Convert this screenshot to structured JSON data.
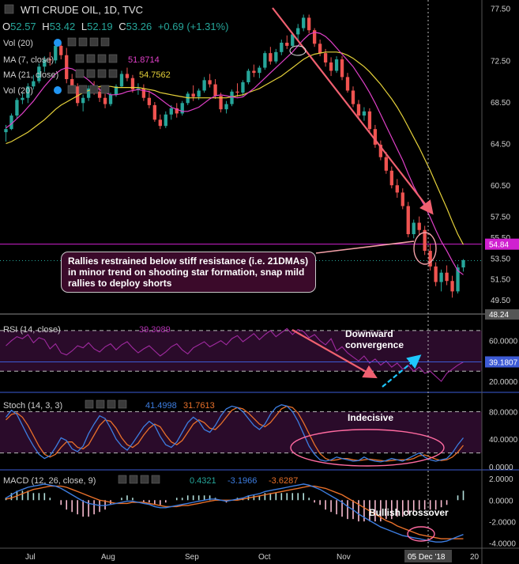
{
  "header": {
    "title": "WTI CRUDE OIL, 1D, TVC",
    "open_label": "O",
    "open": "52.57",
    "high_label": "H",
    "high": "53.42",
    "low_label": "L",
    "low": "52.19",
    "close_label": "C",
    "close": "53.26",
    "change": "+0.69 (+1.31%)"
  },
  "indicators": {
    "vol": "Vol (20)",
    "ma7": "MA (7, close)",
    "ma7_value": "51.8714",
    "ma21": "MA (21, close)",
    "ma21_value": "54.7562",
    "vol2": "Vol (20)",
    "rsi": "RSI (14, close)",
    "rsi_value": "39.3089",
    "stoch": "Stoch (14, 3, 3)",
    "stoch_k": "41.4998",
    "stoch_d": "31.7613",
    "macd": "MACD (12, 26, close, 9)",
    "macd_1": "0.4321",
    "macd_2": "-3.1966",
    "macd_3": "-3.6287"
  },
  "annotations": {
    "note": "Rallies restrained below stiff resistance (i.e. 21DMAs) in minor trend on shooting star formation, snap mild rallies to deploy shorts",
    "rsi_note_1": "Downward",
    "rsi_note_2": "convergence",
    "stoch_note": "Indecisive",
    "macd_note": "Bullish crossover"
  },
  "colors": {
    "up": "#26a69a",
    "down": "#ef5350",
    "ma7": "#e040c8",
    "ma21": "#e6d23a",
    "resistance": "#d020d0",
    "band": "#2a0b2a",
    "trend_arrow": "#f06070",
    "cyan_arrow": "#1ec8ff",
    "macd_line": "#3d7de0",
    "signal_line": "#e8702a",
    "stoch_k": "#3d7de0",
    "stoch_d": "#e8702a"
  },
  "chart_data": {
    "type": "candlestick",
    "x_labels": [
      "Jul",
      "Aug",
      "Sep",
      "Oct",
      "Nov",
      "Dec",
      "20"
    ],
    "cursor_date": "05 Dec '18",
    "price_axis_ticks": [
      "77.50",
      "72.50",
      "68.50",
      "64.50",
      "60.50",
      "57.50",
      "55.50",
      "53.50",
      "51.50",
      "49.50"
    ],
    "price_ylim": [
      48.2,
      78.0
    ],
    "resistance_level": "54.84",
    "last_low_label": "48.24",
    "price_series": [
      [
        65.6,
        66.3,
        64.7,
        65.9
      ],
      [
        65.9,
        67.4,
        65.8,
        67.2
      ],
      [
        67.2,
        68.9,
        66.9,
        68.7
      ],
      [
        68.7,
        69.4,
        68.3,
        68.9
      ],
      [
        68.9,
        70.3,
        68.4,
        70.0
      ],
      [
        70.0,
        71.1,
        69.7,
        70.5
      ],
      [
        70.5,
        72.2,
        70.3,
        71.9
      ],
      [
        71.9,
        72.9,
        71.4,
        72.6
      ],
      [
        72.6,
        73.3,
        72.0,
        72.5
      ],
      [
        72.5,
        74.3,
        72.2,
        73.9
      ],
      [
        73.9,
        74.2,
        72.6,
        73.0
      ],
      [
        73.0,
        73.7,
        70.3,
        70.7
      ],
      [
        70.7,
        71.2,
        69.6,
        70.0
      ],
      [
        70.0,
        70.3,
        68.1,
        68.4
      ],
      [
        68.4,
        69.2,
        67.6,
        68.9
      ],
      [
        68.9,
        70.1,
        68.6,
        69.8
      ],
      [
        69.8,
        70.5,
        69.2,
        69.5
      ],
      [
        69.5,
        70.0,
        68.5,
        68.9
      ],
      [
        68.9,
        69.3,
        67.9,
        68.3
      ],
      [
        68.3,
        69.4,
        68.1,
        69.2
      ],
      [
        69.2,
        70.2,
        69.0,
        70.0
      ],
      [
        70.0,
        71.5,
        69.9,
        71.2
      ],
      [
        71.2,
        71.8,
        70.5,
        70.8
      ],
      [
        70.8,
        71.1,
        69.4,
        69.7
      ],
      [
        69.7,
        70.3,
        69.2,
        69.8
      ],
      [
        69.8,
        70.2,
        68.6,
        68.9
      ],
      [
        68.9,
        69.6,
        67.9,
        68.2
      ],
      [
        68.2,
        68.5,
        66.6,
        66.8
      ],
      [
        66.8,
        67.3,
        65.9,
        66.2
      ],
      [
        66.2,
        67.6,
        66.0,
        67.3
      ],
      [
        67.3,
        68.2,
        66.8,
        67.9
      ],
      [
        67.9,
        68.4,
        67.0,
        67.4
      ],
      [
        67.4,
        68.6,
        67.2,
        68.4
      ],
      [
        68.4,
        69.5,
        68.2,
        69.3
      ],
      [
        69.3,
        70.1,
        68.6,
        69.0
      ],
      [
        69.0,
        69.8,
        68.7,
        69.6
      ],
      [
        69.6,
        70.9,
        69.4,
        70.6
      ],
      [
        70.6,
        71.2,
        69.9,
        70.2
      ],
      [
        70.2,
        70.7,
        68.8,
        69.1
      ],
      [
        69.1,
        69.4,
        67.5,
        67.8
      ],
      [
        67.8,
        68.6,
        67.4,
        68.3
      ],
      [
        68.3,
        69.7,
        68.1,
        69.5
      ],
      [
        69.5,
        70.3,
        69.0,
        69.4
      ],
      [
        69.4,
        70.6,
        69.1,
        70.4
      ],
      [
        70.4,
        71.7,
        70.2,
        71.5
      ],
      [
        71.5,
        72.1,
        70.9,
        71.3
      ],
      [
        71.3,
        72.0,
        70.8,
        71.8
      ],
      [
        71.8,
        73.4,
        71.6,
        73.2
      ],
      [
        73.2,
        73.8,
        72.1,
        72.4
      ],
      [
        72.4,
        73.6,
        72.2,
        73.3
      ],
      [
        73.3,
        74.5,
        73.0,
        74.2
      ],
      [
        74.2,
        74.9,
        73.6,
        73.9
      ],
      [
        73.9,
        75.2,
        73.8,
        75.0
      ],
      [
        75.0,
        76.0,
        74.4,
        75.6
      ],
      [
        75.6,
        76.9,
        75.3,
        76.6
      ],
      [
        76.6,
        76.9,
        75.1,
        75.4
      ],
      [
        75.4,
        75.6,
        73.8,
        74.1
      ],
      [
        74.1,
        74.5,
        72.9,
        73.2
      ],
      [
        73.2,
        73.6,
        71.9,
        72.3
      ],
      [
        72.3,
        72.8,
        71.0,
        71.5
      ],
      [
        71.5,
        72.9,
        71.3,
        72.6
      ],
      [
        72.6,
        72.9,
        70.6,
        70.9
      ],
      [
        70.9,
        71.3,
        69.4,
        69.6
      ],
      [
        69.6,
        70.0,
        68.0,
        68.3
      ],
      [
        68.3,
        68.7,
        66.9,
        67.2
      ],
      [
        67.2,
        68.0,
        66.7,
        67.6
      ],
      [
        67.6,
        67.9,
        65.6,
        65.9
      ],
      [
        65.9,
        66.3,
        64.1,
        64.4
      ],
      [
        64.4,
        64.8,
        62.9,
        63.2
      ],
      [
        63.2,
        63.7,
        61.6,
        61.9
      ],
      [
        61.9,
        62.3,
        60.2,
        60.5
      ],
      [
        60.5,
        61.1,
        59.3,
        59.8
      ],
      [
        59.8,
        60.2,
        58.2,
        58.5
      ],
      [
        58.5,
        58.9,
        55.5,
        55.8
      ],
      [
        55.8,
        57.2,
        55.4,
        56.9
      ],
      [
        56.9,
        57.5,
        55.8,
        56.2
      ],
      [
        56.2,
        56.6,
        53.8,
        54.2
      ],
      [
        54.2,
        54.9,
        52.3,
        52.7
      ],
      [
        52.7,
        53.1,
        50.8,
        51.2
      ],
      [
        51.2,
        52.4,
        50.3,
        52.1
      ],
      [
        52.1,
        52.8,
        50.9,
        51.3
      ],
      [
        51.3,
        51.8,
        49.7,
        50.3
      ],
      [
        50.3,
        52.9,
        50.1,
        52.6
      ],
      [
        52.6,
        53.4,
        52.2,
        53.3
      ]
    ],
    "ma7": [
      66.0,
      66.4,
      66.9,
      67.4,
      68.0,
      68.6,
      69.3,
      70.0,
      70.6,
      71.2,
      71.6,
      71.8,
      71.7,
      71.4,
      71.0,
      70.6,
      70.1,
      69.7,
      69.4,
      69.2,
      69.2,
      69.3,
      69.5,
      69.6,
      69.7,
      69.6,
      69.5,
      69.2,
      68.8,
      68.4,
      68.0,
      67.8,
      67.6,
      67.6,
      67.8,
      68.0,
      68.4,
      68.8,
      69.1,
      69.2,
      69.1,
      69.0,
      68.9,
      69.0,
      69.4,
      69.8,
      70.3,
      70.8,
      71.3,
      71.8,
      72.3,
      72.8,
      73.3,
      73.9,
      74.5,
      75.0,
      75.2,
      75.1,
      74.8,
      74.3,
      73.7,
      73.1,
      72.5,
      71.9,
      71.1,
      70.3,
      69.4,
      68.4,
      67.3,
      66.2,
      65.1,
      64.0,
      62.9,
      61.6,
      60.4,
      59.4,
      58.5,
      57.4,
      56.2,
      55.1,
      54.2,
      53.2,
      52.3,
      51.9
    ],
    "ma21": [
      64.5,
      64.7,
      65.0,
      65.3,
      65.6,
      66.0,
      66.4,
      66.8,
      67.3,
      67.8,
      68.2,
      68.5,
      68.8,
      69.1,
      69.4,
      69.6,
      69.8,
      70.0,
      70.0,
      70.0,
      69.9,
      69.9,
      69.9,
      69.9,
      69.9,
      69.8,
      69.7,
      69.6,
      69.4,
      69.3,
      69.2,
      69.1,
      69.0,
      68.9,
      68.9,
      68.9,
      68.9,
      68.9,
      68.9,
      68.9,
      68.9,
      69.0,
      69.1,
      69.2,
      69.4,
      69.6,
      69.8,
      70.1,
      70.4,
      70.7,
      71.0,
      71.4,
      71.8,
      72.2,
      72.6,
      72.9,
      73.1,
      73.2,
      73.3,
      73.3,
      73.3,
      73.2,
      73.0,
      72.7,
      72.3,
      71.9,
      71.4,
      70.8,
      70.2,
      69.5,
      68.8,
      68.0,
      67.1,
      66.1,
      65.1,
      64.1,
      63.0,
      61.9,
      60.7,
      59.5,
      58.3,
      57.0,
      55.8,
      54.8
    ],
    "rsi_ylim": [
      10,
      80
    ],
    "rsi_ticks": [
      "60.0000",
      "39.1807",
      "20.0000"
    ],
    "rsi_levels": [
      70,
      30
    ],
    "rsi": [
      55,
      60,
      64,
      62,
      66,
      58,
      63,
      61,
      52,
      57,
      48,
      46,
      50,
      55,
      53,
      58,
      52,
      49,
      54,
      57,
      51,
      56,
      59,
      53,
      48,
      52,
      55,
      50,
      45,
      49,
      54,
      57,
      51,
      47,
      53,
      56,
      59,
      54,
      57,
      60,
      56,
      62,
      65,
      59,
      63,
      67,
      61,
      66,
      70,
      64,
      68,
      72,
      66,
      71,
      69,
      63,
      66,
      60,
      56,
      62,
      50,
      54,
      48,
      44,
      40,
      45,
      38,
      42,
      36,
      40,
      34,
      38,
      32,
      36,
      30,
      34,
      28,
      30,
      25,
      20,
      28,
      32,
      36,
      39
    ],
    "stoch_ylim": [
      0,
      100
    ],
    "stoch_ticks": [
      "80.0000",
      "40.0000",
      "0.0000"
    ],
    "stoch_levels": [
      80,
      20
    ],
    "stoch_k_series": [
      72,
      82,
      76,
      60,
      44,
      30,
      18,
      12,
      16,
      28,
      42,
      38,
      26,
      22,
      30,
      48,
      62,
      74,
      70,
      56,
      40,
      30,
      24,
      34,
      46,
      58,
      66,
      60,
      44,
      32,
      28,
      36,
      50,
      64,
      72,
      66,
      54,
      50,
      60,
      74,
      84,
      88,
      86,
      80,
      70,
      60,
      54,
      62,
      76,
      86,
      90,
      88,
      80,
      66,
      48,
      30,
      18,
      10,
      8,
      10,
      14,
      12,
      10,
      8,
      9,
      14,
      10,
      8,
      7,
      9,
      12,
      10,
      8,
      12,
      16,
      20,
      14,
      10,
      8,
      10,
      12,
      20,
      32,
      42
    ],
    "stoch_d_series": [
      68,
      76,
      78,
      72,
      60,
      45,
      30,
      18,
      14,
      18,
      28,
      36,
      36,
      28,
      26,
      32,
      46,
      60,
      68,
      66,
      56,
      42,
      32,
      28,
      34,
      46,
      56,
      62,
      58,
      46,
      36,
      32,
      38,
      50,
      62,
      68,
      64,
      56,
      54,
      62,
      72,
      82,
      86,
      84,
      78,
      70,
      62,
      58,
      64,
      74,
      84,
      88,
      86,
      78,
      64,
      48,
      32,
      19,
      12,
      9,
      10,
      12,
      12,
      10,
      9,
      10,
      11,
      10,
      9,
      8,
      9,
      10,
      10,
      10,
      12,
      16,
      17,
      14,
      11,
      9,
      10,
      14,
      21,
      31
    ],
    "macd_ylim": [
      -4.4,
      2.6
    ],
    "macd_ticks": [
      "2.0000",
      "0.0000",
      "-2.0000",
      "-4.0000"
    ],
    "macd_line": [
      0.2,
      0.5,
      0.8,
      1.0,
      1.2,
      1.3,
      1.4,
      1.5,
      1.4,
      1.3,
      1.1,
      0.8,
      0.5,
      0.2,
      -0.1,
      -0.3,
      -0.4,
      -0.5,
      -0.5,
      -0.4,
      -0.3,
      -0.2,
      -0.1,
      -0.1,
      -0.2,
      -0.3,
      -0.4,
      -0.6,
      -0.7,
      -0.7,
      -0.6,
      -0.5,
      -0.4,
      -0.3,
      -0.2,
      -0.1,
      0.0,
      0.1,
      0.1,
      0.0,
      -0.1,
      0.0,
      0.1,
      0.2,
      0.4,
      0.5,
      0.6,
      0.8,
      0.9,
      1.0,
      1.1,
      1.2,
      1.3,
      1.4,
      1.5,
      1.4,
      1.2,
      1.0,
      0.7,
      0.4,
      0.1,
      -0.2,
      -0.6,
      -0.9,
      -1.3,
      -1.6,
      -1.9,
      -2.2,
      -2.5,
      -2.7,
      -2.9,
      -3.1,
      -3.3,
      -3.4,
      -3.5,
      -3.6,
      -3.7,
      -3.8,
      -3.9,
      -3.9,
      -3.8,
      -3.6,
      -3.4,
      -3.2
    ],
    "signal_line": [
      0.1,
      0.2,
      0.4,
      0.6,
      0.8,
      1.0,
      1.1,
      1.2,
      1.3,
      1.3,
      1.3,
      1.2,
      1.0,
      0.8,
      0.6,
      0.4,
      0.2,
      0.0,
      -0.1,
      -0.2,
      -0.3,
      -0.3,
      -0.3,
      -0.2,
      -0.2,
      -0.2,
      -0.3,
      -0.4,
      -0.5,
      -0.6,
      -0.6,
      -0.6,
      -0.5,
      -0.5,
      -0.4,
      -0.3,
      -0.2,
      -0.1,
      0.0,
      0.0,
      0.0,
      0.0,
      0.0,
      0.1,
      0.2,
      0.3,
      0.4,
      0.5,
      0.6,
      0.7,
      0.8,
      0.9,
      1.0,
      1.1,
      1.2,
      1.3,
      1.3,
      1.2,
      1.1,
      0.9,
      0.7,
      0.5,
      0.2,
      -0.1,
      -0.4,
      -0.7,
      -1.0,
      -1.3,
      -1.6,
      -1.9,
      -2.1,
      -2.4,
      -2.6,
      -2.8,
      -3.0,
      -3.2,
      -3.3,
      -3.4,
      -3.5,
      -3.6,
      -3.6,
      -3.6,
      -3.6,
      -3.6
    ]
  }
}
